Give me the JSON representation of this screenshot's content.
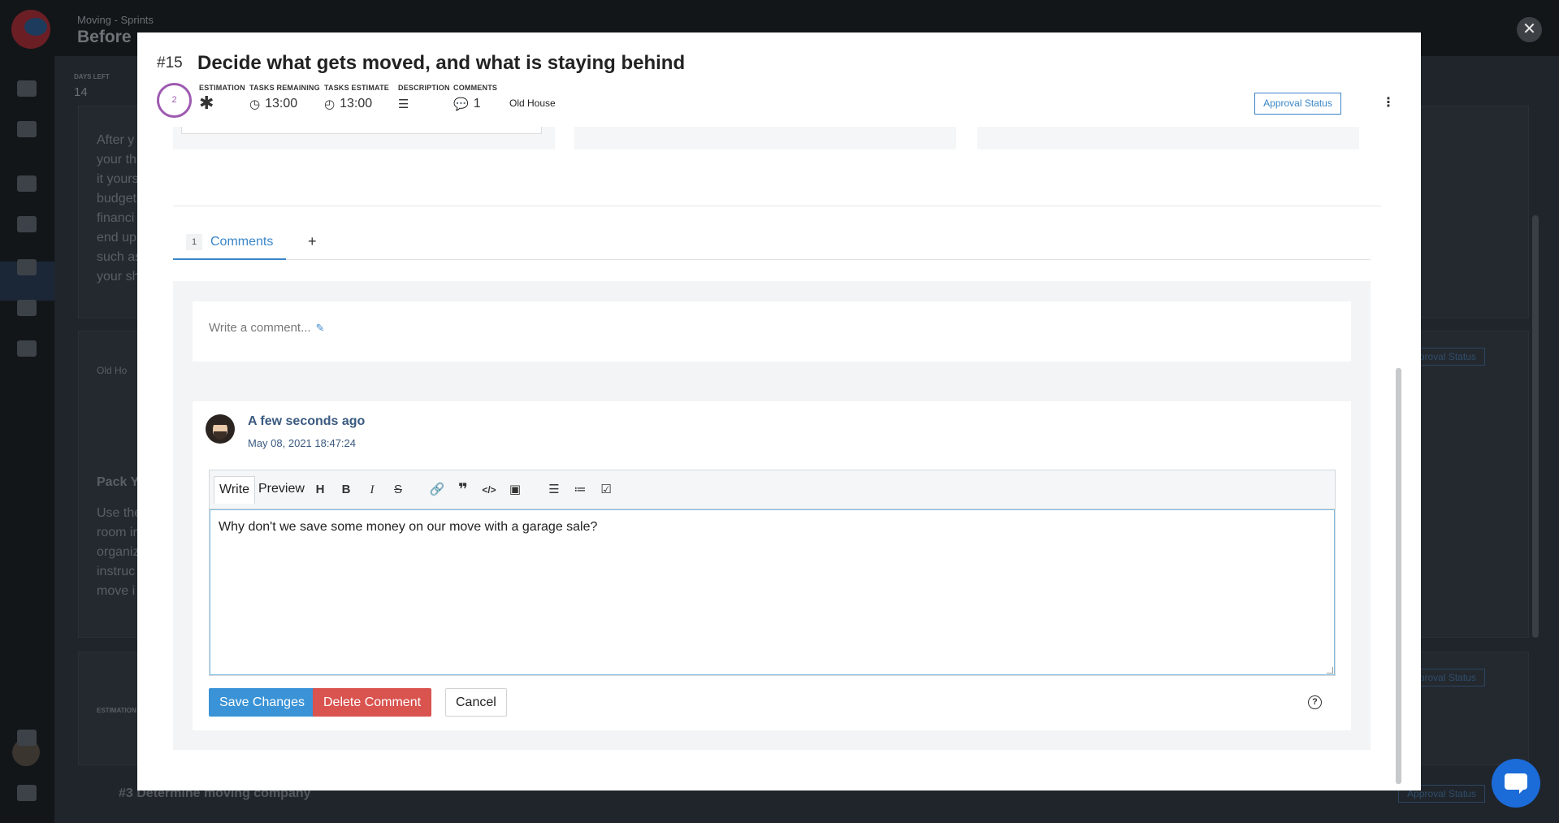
{
  "background": {
    "breadcrumb": "Moving - Sprints",
    "title": "Before",
    "days_left_label": "DAYS LEFT",
    "days_left_value": "14",
    "approval_label": "Approval Status",
    "bottom_item_number": "#3",
    "bottom_item_title": "Determine moving company",
    "card_text_lines": [
      "After y",
      "your th",
      "it yours",
      "budget",
      "financi",
      "end up",
      "such as",
      "your sh"
    ],
    "card2_text_lines": [
      "Use the",
      "room in",
      "organiz",
      "instruc",
      "move i"
    ],
    "card2_title": "Pack Y",
    "card2_tag": "Old Ho",
    "card3_label": "ESTIMATION"
  },
  "modal": {
    "number": "#15",
    "title": "Decide what gets moved, and what is staying behind",
    "estimation_ring": "2",
    "metrics": {
      "estimation_label": "ESTIMATION",
      "tasks_remaining_label": "TASKS REMAINING",
      "tasks_remaining_value": "13:00",
      "tasks_estimate_label": "TASKS ESTIMATE",
      "tasks_estimate_value": "13:00",
      "description_label": "DESCRIPTION",
      "comments_label": "COMMENTS",
      "comments_value": "1"
    },
    "tag": "Old House",
    "approval_status": "Approval Status"
  },
  "tabs": {
    "comments_count": "1",
    "comments_label": "Comments",
    "add_label": "+"
  },
  "new_comment": {
    "placeholder": "Write a comment..."
  },
  "comment": {
    "author_line": "A few seconds ago",
    "date": "May 08, 2021 18:47:24",
    "editor": {
      "write_tab": "Write",
      "preview_tab": "Preview",
      "body": "Why don't we save some money on our move with a garage sale?"
    },
    "buttons": {
      "save": "Save Changes",
      "delete": "Delete Comment",
      "cancel": "Cancel"
    }
  },
  "colors": {
    "accent": "#3a86c8",
    "estimation_ring": "#9e5ab1",
    "delete": "#d9534f",
    "chat": "#1b6bd8"
  }
}
